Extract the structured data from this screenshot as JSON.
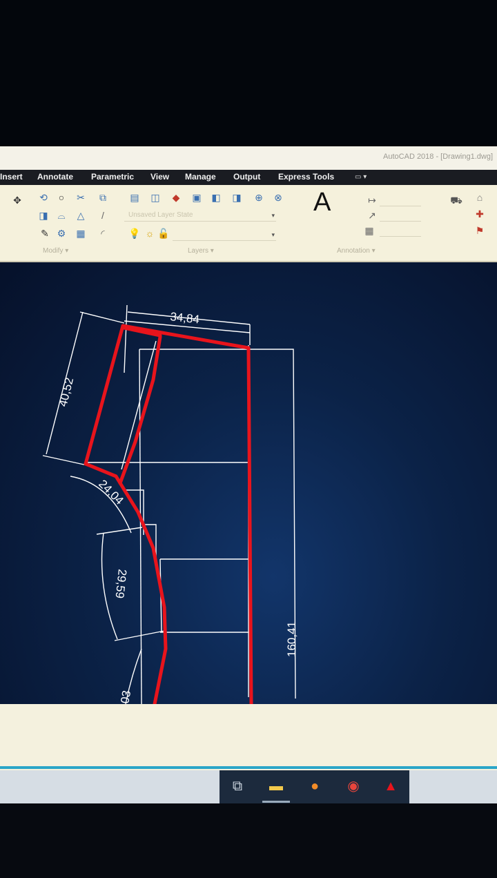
{
  "window": {
    "title": "AutoCAD 2018 - [Drawing1.dwg]"
  },
  "menu": [
    {
      "label": "Insert"
    },
    {
      "label": "Annotate"
    },
    {
      "label": "Parametric"
    },
    {
      "label": "View"
    },
    {
      "label": "Manage"
    },
    {
      "label": "Output"
    },
    {
      "label": "Express Tools"
    }
  ],
  "ribbon": {
    "panels": [
      {
        "label": "Modify ▾"
      },
      {
        "label": "Layers ▾"
      },
      {
        "label": "Annotation ▾"
      }
    ],
    "layer_dropdown": "Unsaved Layer State",
    "text_icon_letter": "A"
  },
  "drawing": {
    "dimensions": [
      "34,84",
      "40,52",
      "24,04",
      "29,59",
      "160,41",
      "03"
    ],
    "colors": {
      "pattern": "#e8141c",
      "dimension": "#ffffff",
      "background": "#0b2247"
    }
  },
  "taskbar": {
    "icons": [
      "task-view-icon",
      "file-explorer-icon",
      "firefox-icon",
      "chrome-icon",
      "autocad-icon"
    ]
  }
}
